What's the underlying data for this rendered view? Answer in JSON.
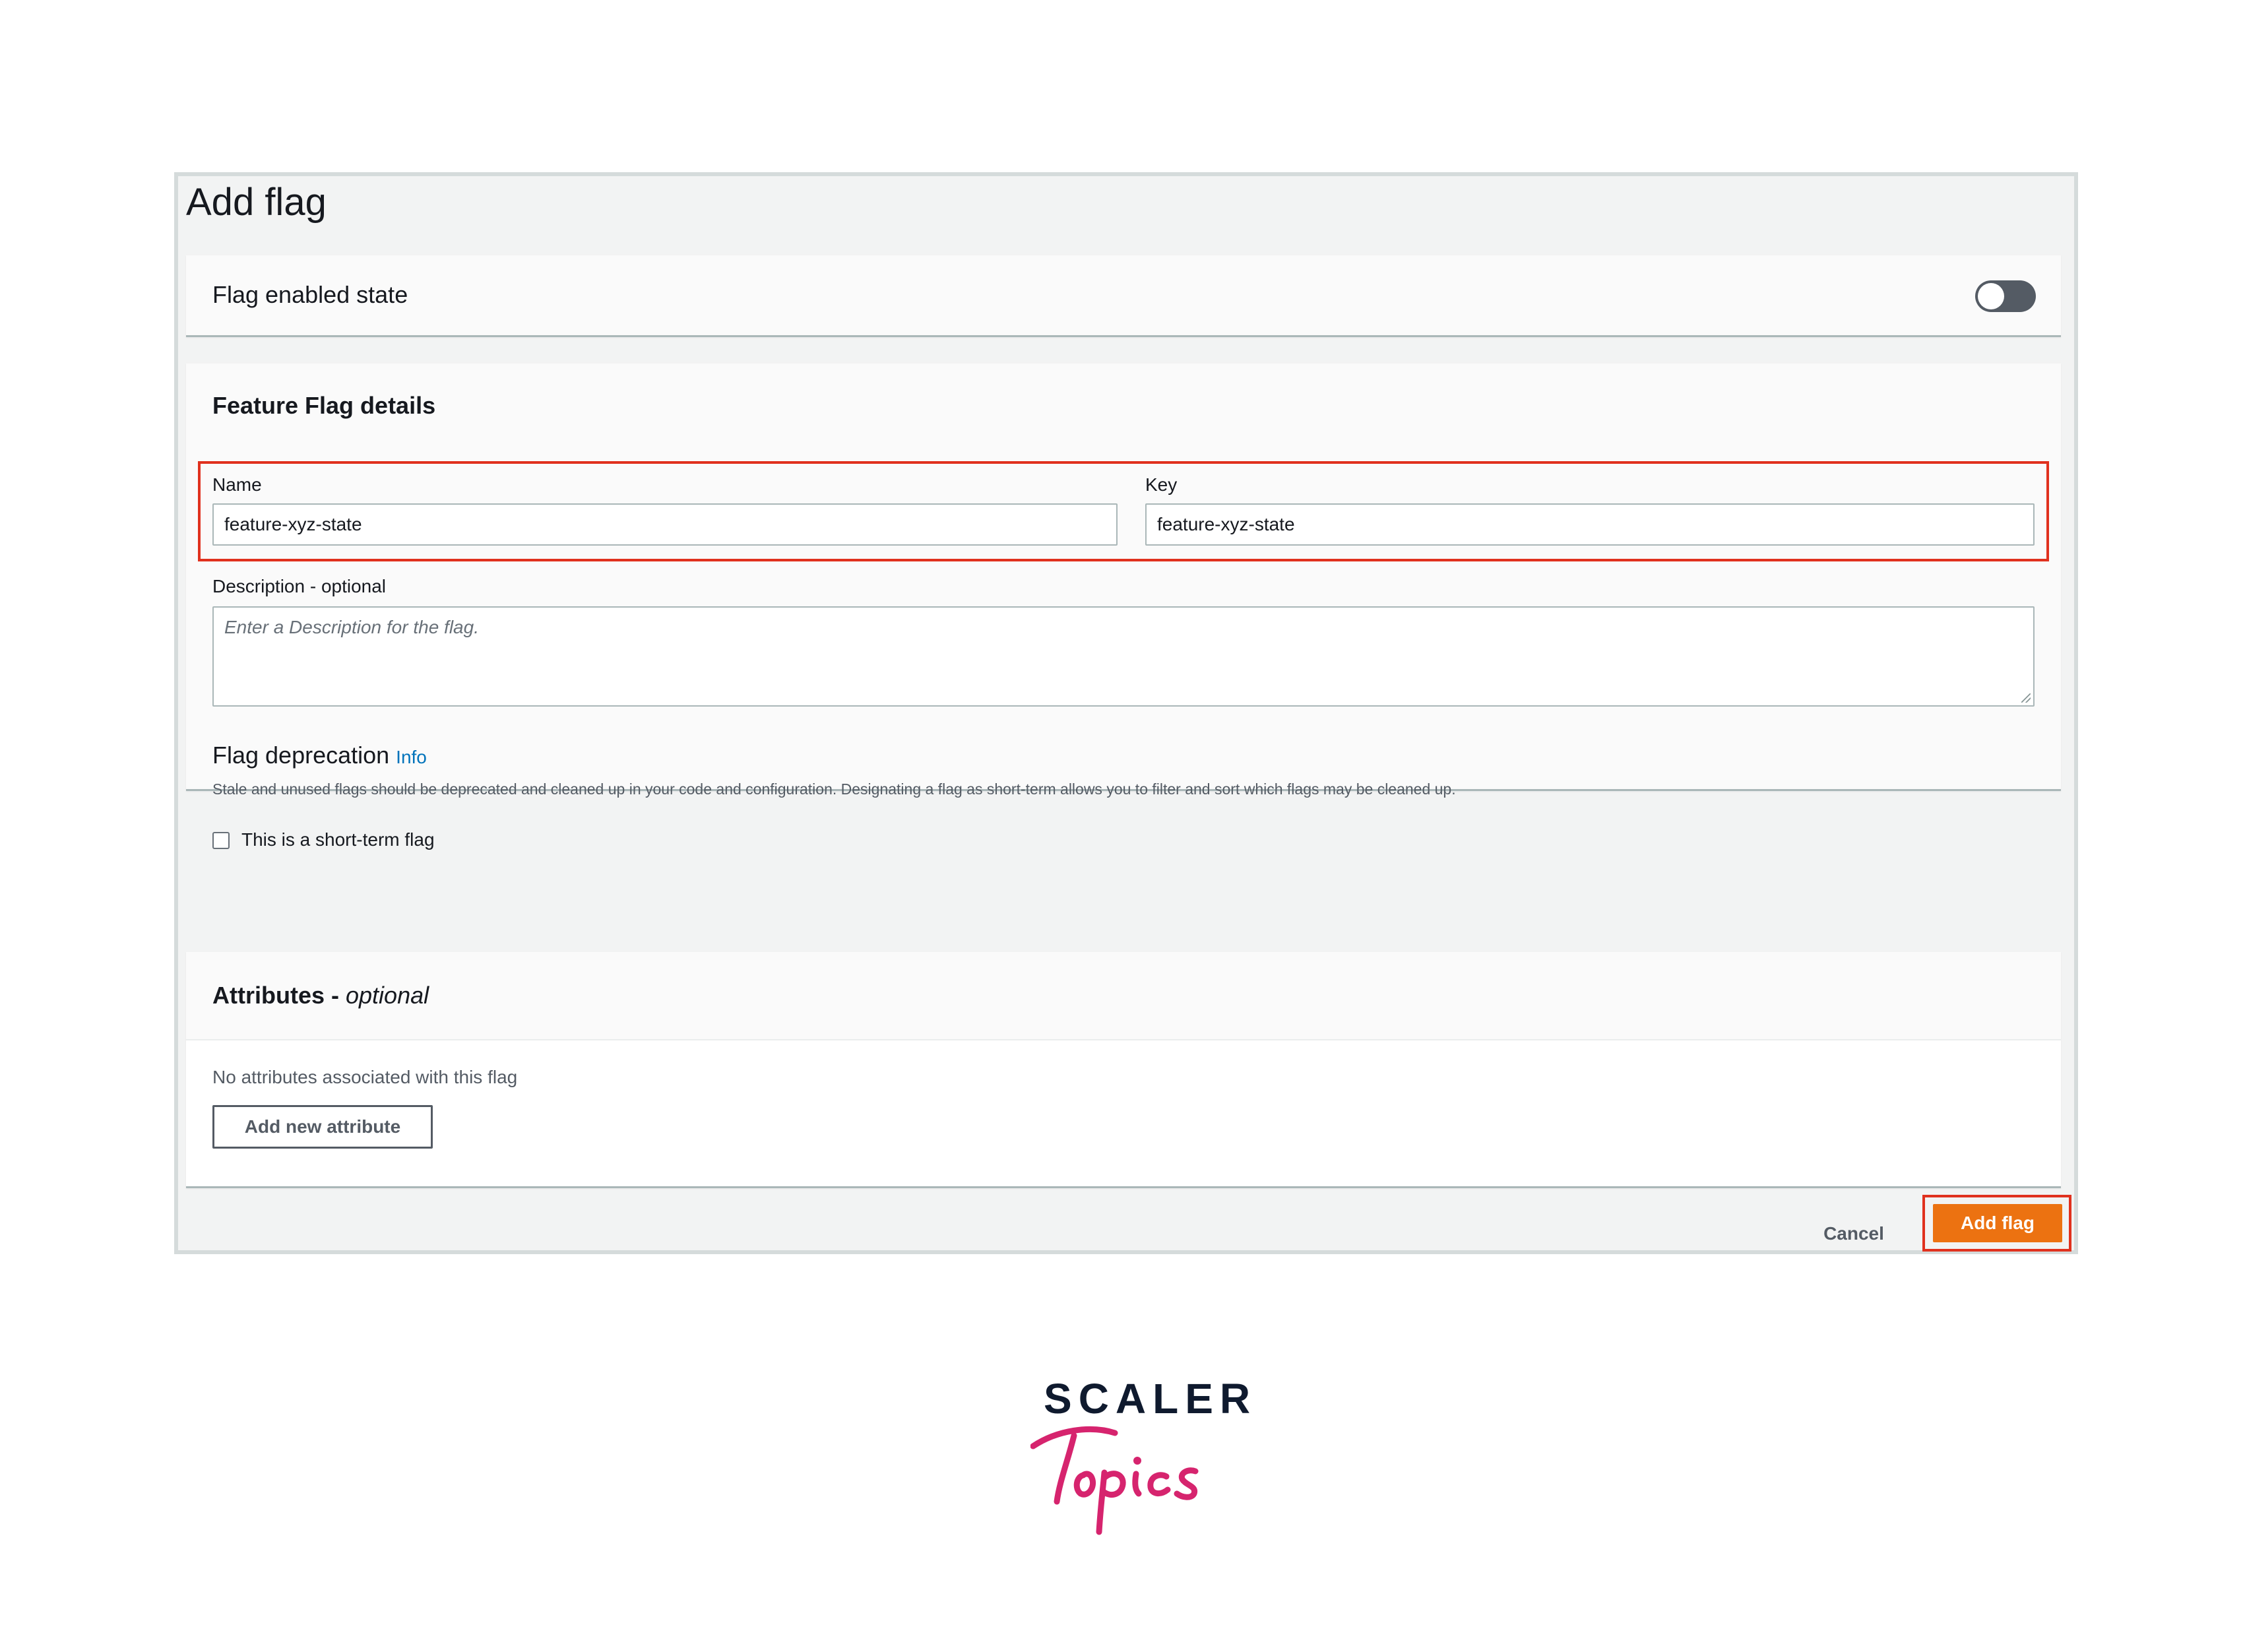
{
  "page": {
    "title": "Add flag"
  },
  "enabled_panel": {
    "label": "Flag enabled state",
    "toggle_on": false
  },
  "details": {
    "title": "Feature Flag details",
    "name": {
      "label": "Name",
      "value": "feature-xyz-state"
    },
    "key": {
      "label": "Key",
      "value": "feature-xyz-state"
    },
    "description": {
      "label": "Description - optional",
      "placeholder": "Enter a Description for the flag."
    },
    "deprecation": {
      "title": "Flag deprecation",
      "info_link": "Info",
      "help": "Stale and unused flags should be deprecated and cleaned up in your code and configuration. Designating a flag as short-term allows you to filter and sort which flags may be cleaned up.",
      "checkbox_label": "This is a short-term flag",
      "checked": false
    }
  },
  "attributes": {
    "title": "Attributes",
    "title_separator": " - ",
    "title_optional": "optional",
    "empty_text": "No attributes associated with this flag",
    "add_button": "Add new attribute"
  },
  "footer": {
    "cancel_label": "Cancel",
    "submit_label": "Add flag"
  },
  "colors": {
    "accent": "#ec7211",
    "highlight": "#e0311e",
    "link": "#0073bb"
  },
  "logo": {
    "line1": "SCALER",
    "line2": "Topics",
    "brand_color": "#d6246e"
  }
}
